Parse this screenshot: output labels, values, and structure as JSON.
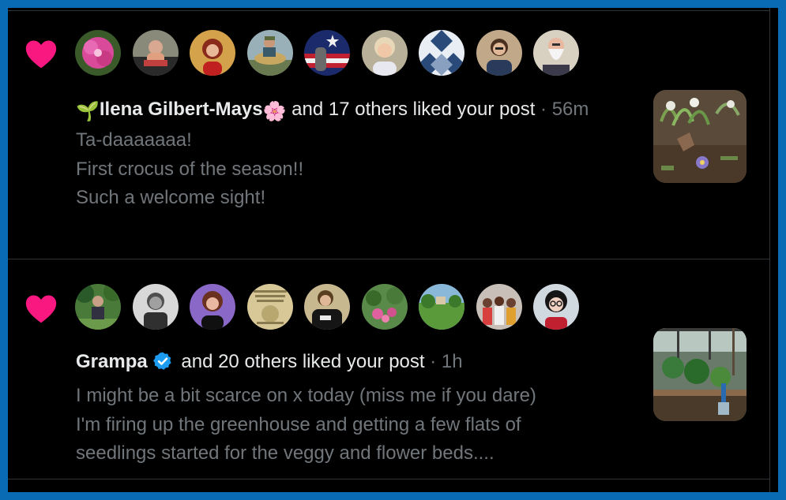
{
  "notifications": [
    {
      "icon": "heart-icon",
      "avatars": [
        "pink-flower",
        "person-beach",
        "woman-red-hair",
        "man-fishing",
        "flag-hand",
        "woman-short-hair",
        "quilt-pattern",
        "woman-glasses",
        "man-white-beard"
      ],
      "name": "Ilena Gilbert-Mays",
      "prefix_emoji": "🌱",
      "suffix_emoji": "🌸",
      "action": " and 17 others liked your post",
      "separator": " · ",
      "time": "56m",
      "preview_lines": [
        "Ta-daaaaaaa!",
        "First crocus of the season!!",
        "Such a welcome sight!"
      ],
      "thumbnail": "crocus-photo"
    },
    {
      "icon": "heart-icon",
      "avatars": [
        "man-garden",
        "vintage-portrait",
        "woman-purple",
        "meme-text",
        "man-yes-shirt",
        "garden-flowers",
        "garden-lawn",
        "group-people",
        "woman-dark-hair-glasses"
      ],
      "name": "Grampa",
      "verified": true,
      "action": " and 20 others liked your post",
      "separator": " · ",
      "time": "1h",
      "preview_lines": [
        "I might be a bit scarce on x today (miss me if you dare)",
        "I'm firing up the greenhouse and getting a few flats of",
        "seedlings started for the veggy and flower beds...."
      ],
      "thumbnail": "greenhouse-photo"
    }
  ],
  "colors": {
    "heart": "#f91880",
    "verified": "#1d9bf0",
    "muted": "#71767b",
    "text": "#e7e9ea",
    "frame": "#0a6bb5"
  }
}
